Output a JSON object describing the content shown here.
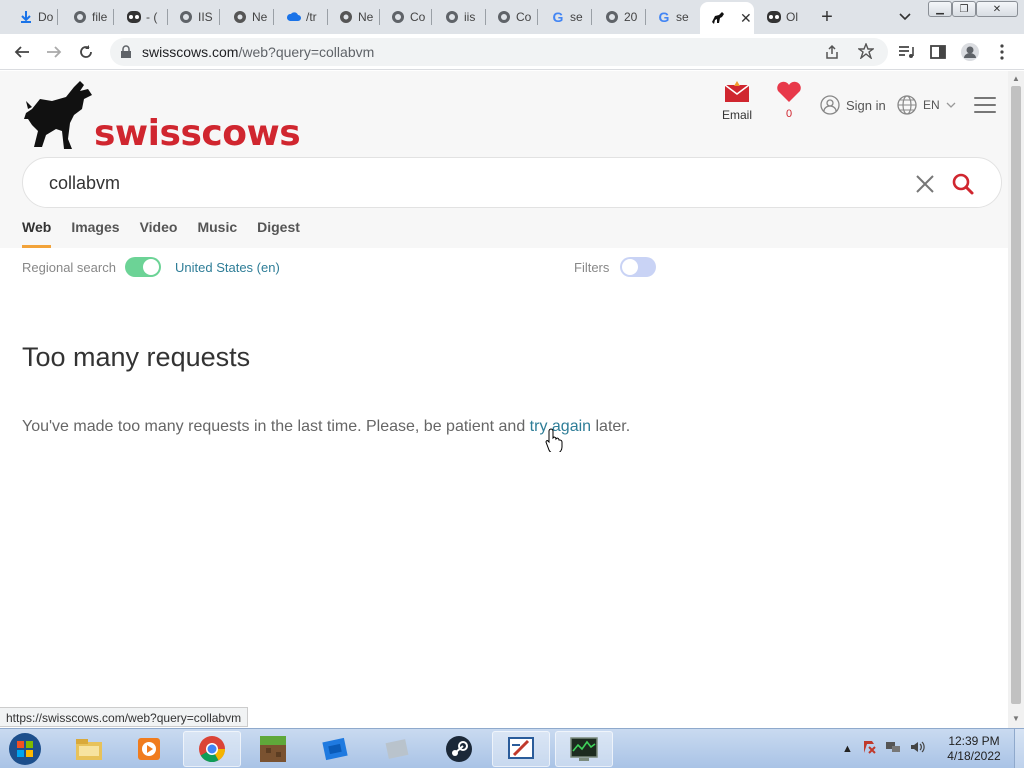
{
  "browser": {
    "tabs": [
      {
        "title": "Do",
        "icon": "download-icon"
      },
      {
        "title": "file",
        "icon": "globe-icon"
      },
      {
        "title": "- (",
        "icon": "ghost-icon"
      },
      {
        "title": "IIS",
        "icon": "globe-icon"
      },
      {
        "title": "Ne",
        "icon": "chrome-icon"
      },
      {
        "title": "/tr",
        "icon": "cloud-icon"
      },
      {
        "title": "Ne",
        "icon": "chrome-icon"
      },
      {
        "title": "Co",
        "icon": "globe-icon"
      },
      {
        "title": "iis",
        "icon": "globe-icon"
      },
      {
        "title": "Co",
        "icon": "globe-icon"
      },
      {
        "title": "se",
        "icon": "google-icon"
      },
      {
        "title": "20",
        "icon": "globe-icon"
      },
      {
        "title": "se",
        "icon": "google-icon"
      },
      {
        "title": "",
        "icon": "swisscows-icon",
        "active": true
      },
      {
        "title": "Ol",
        "icon": "ghost-icon"
      }
    ],
    "url_host": "swisscows.com",
    "url_path": "/web?query=collabvm",
    "status_url": "https://swisscows.com/web?query=collabvm"
  },
  "page": {
    "logo_text": "swisscows",
    "email_label": "Email",
    "fav_count": "0",
    "signin_label": "Sign in",
    "lang_label": "EN",
    "search_value": "collabvm",
    "nav_tabs": [
      "Web",
      "Images",
      "Video",
      "Music",
      "Digest"
    ],
    "regional_label": "Regional search",
    "region_value": "United States (en)",
    "filters_label": "Filters",
    "error_title": "Too many requests",
    "error_text_before": "You've made too many requests in the last time. Please, be patient and ",
    "error_link": "try again",
    "error_text_after": " later.",
    "colors": {
      "brand_red": "#d0262f",
      "toggle_on": "#6cd396",
      "toggle_off": "#c9d3f5",
      "link": "#2e7d97",
      "tab_underline": "#f2a33a"
    }
  },
  "taskbar": {
    "apps": [
      "explorer-icon",
      "media-player-icon",
      "chrome-icon",
      "minecraft-icon",
      "roblox-icon",
      "app-icon",
      "steam-icon",
      "paint-icon",
      "task-manager-icon"
    ],
    "time": "12:39 PM",
    "date": "4/18/2022"
  }
}
